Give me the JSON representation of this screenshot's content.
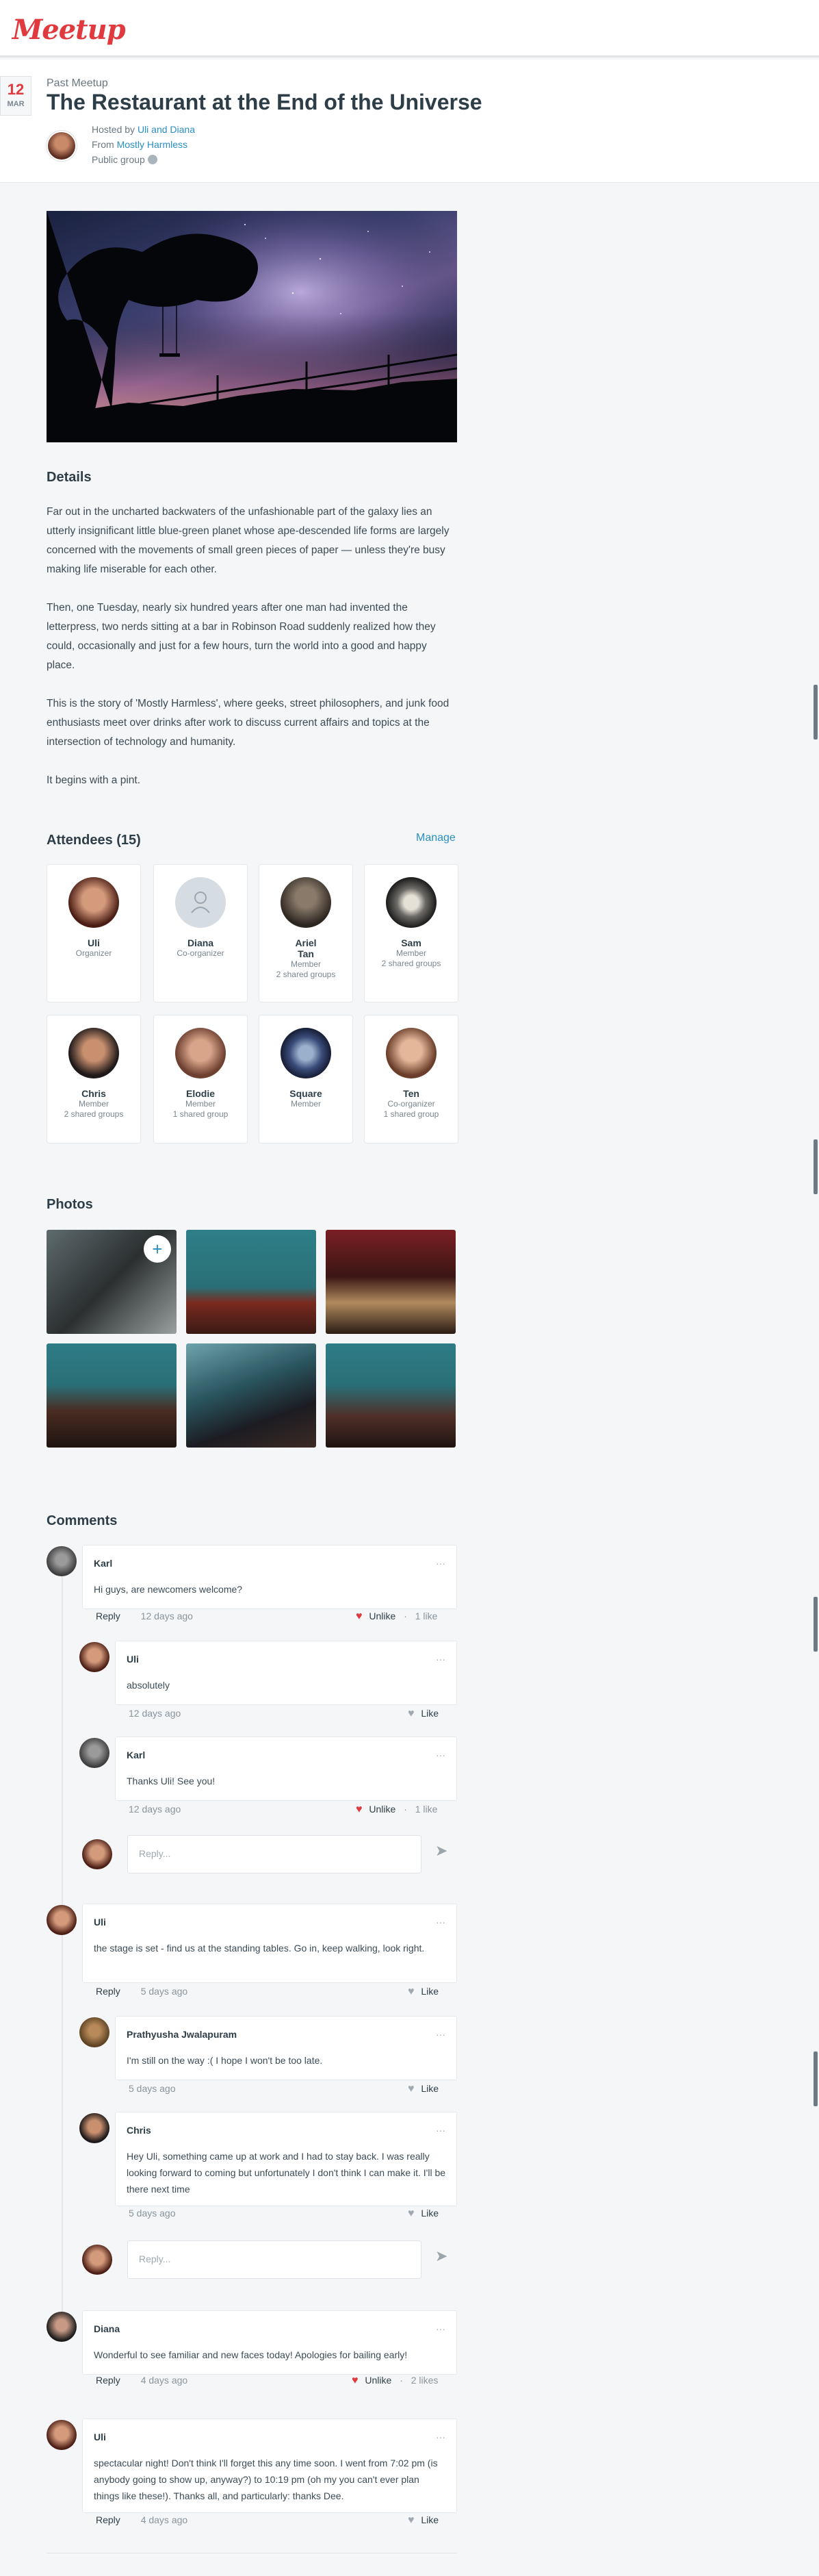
{
  "brand": {
    "logo_text": "Meetup",
    "accent": "#e0393e",
    "link_color": "#2a8fc4"
  },
  "event": {
    "date_day": "12",
    "date_month": "MAR",
    "status": "Past Meetup",
    "title": "The Restaurant at the End of the Universe",
    "hosted_by_prefix": "Hosted by ",
    "hosted_by": "Uli and Diana",
    "from_prefix": "From ",
    "from_group": "Mostly Harmless",
    "visibility": "Public group"
  },
  "details": {
    "heading": "Details",
    "paragraphs": [
      "Far out in the uncharted backwaters of the unfashionable part of the galaxy lies an utterly insignificant little blue-green planet whose ape-descended life forms are largely concerned with the movements of small green pieces of paper — unless they're busy making life miserable for each other.",
      "Then, one Tuesday, nearly six hundred years after one man had invented the letterpress, two nerds sitting at a bar in Robinson Road suddenly realized how they could, occasionally and just for a few hours, turn the world into a good and happy place.",
      "This is the story of 'Mostly Harmless', where geeks, street philosophers, and junk food enthusiasts meet over drinks after work to discuss current affairs and topics at the intersection of technology and humanity.",
      "It begins with a pint."
    ]
  },
  "attendees": {
    "heading": "Attendees (15)",
    "manage_label": "Manage",
    "people": [
      {
        "name": "Uli",
        "role": "Organizer",
        "shared": ""
      },
      {
        "name": "Diana",
        "role": "Co-organizer",
        "shared": ""
      },
      {
        "name": "Ariel Tan",
        "role": "Member",
        "shared": "2 shared groups"
      },
      {
        "name": "Sam",
        "role": "Member",
        "shared": "2 shared groups"
      },
      {
        "name": "Chris",
        "role": "Member",
        "shared": "2 shared groups"
      },
      {
        "name": "Elodie",
        "role": "Member",
        "shared": "1 shared group"
      },
      {
        "name": "Square",
        "role": "Member",
        "shared": ""
      },
      {
        "name": "Ten",
        "role": "Co-organizer",
        "shared": "1 shared group"
      }
    ]
  },
  "photos": {
    "heading": "Photos"
  },
  "comments": {
    "heading": "Comments",
    "reply_label": "Reply",
    "like_label": "Like",
    "unlike_label": "Unlike",
    "reply_placeholder": "Reply...",
    "more_glyph": "···",
    "items": [
      {
        "author": "Karl",
        "text": "Hi guys, are newcomers welcome?",
        "time": "12 days ago",
        "liked": true,
        "likes": "1 like"
      },
      {
        "author": "Uli",
        "text": "absolutely",
        "time": "12 days ago",
        "liked": false,
        "likes": ""
      },
      {
        "author": "Karl",
        "text": "Thanks Uli! See you!",
        "time": "12 days ago",
        "liked": true,
        "likes": "1 like"
      },
      {
        "author": "Uli",
        "text": "the stage is set - find us at the standing tables. Go in, keep walking, look right.",
        "time": "5 days ago",
        "liked": false,
        "likes": ""
      },
      {
        "author": "Prathyusha Jwalapuram",
        "text": "I'm still on the way :( I hope I won't be too late.",
        "time": "5 days ago",
        "liked": false,
        "likes": ""
      },
      {
        "author": "Chris",
        "text": "Hey Uli, something came up at work and I had to stay back. I was really looking forward to coming but unfortunately I don't think I can make it. I'll be there next time",
        "time": "5 days ago",
        "liked": false,
        "likes": ""
      },
      {
        "author": "Diana",
        "text": "Wonderful to see familiar and new faces today! Apologies for bailing early!",
        "time": "4 days ago",
        "liked": true,
        "likes": "2 likes"
      },
      {
        "author": "Uli",
        "text": "spectacular night! Don't think I'll forget this any time soon. I went from 7:02 pm (is anybody going to show up, anyway?) to 10:19 pm (oh my you can't ever plan things like these!). Thanks all, and particularly: thanks Dee.",
        "time": "4 days ago",
        "liked": false,
        "likes": ""
      }
    ]
  }
}
